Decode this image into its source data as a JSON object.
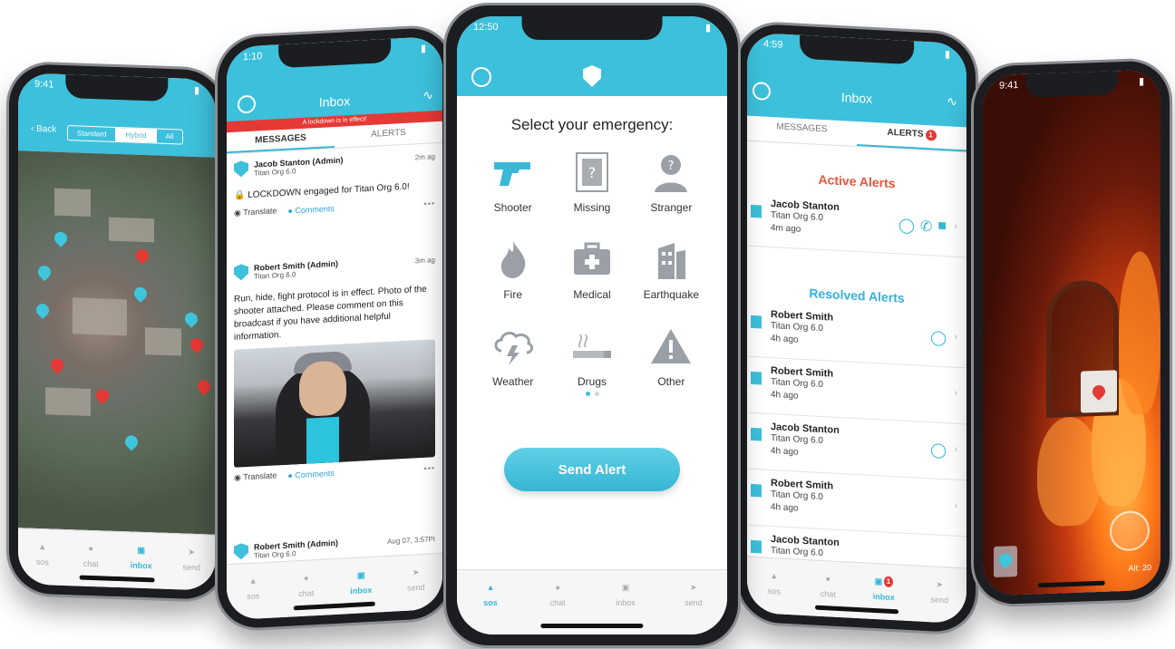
{
  "colors": {
    "accent": "#3dc0db",
    "alert_red": "#e53935",
    "active_alerts": "#e8553a",
    "resolved_alerts": "#35b0e3",
    "link": "#2f9fd6"
  },
  "tabs": {
    "sos": "sos",
    "chat": "chat",
    "inbox": "inbox",
    "send": "send"
  },
  "map_phone": {
    "time": "9:41",
    "back": "Back",
    "segments": [
      "Standard",
      "Hybrid",
      "All"
    ]
  },
  "inbox_phone": {
    "time": "1:10",
    "title": "Inbox",
    "banner": "A lockdown is in effect!",
    "tab_messages": "MESSAGES",
    "tab_alerts": "ALERTS",
    "messages": [
      {
        "from": "Jacob Stanton (Admin)",
        "org": "Titan Org 6.0",
        "time": "2m ag",
        "body": "LOCKDOWN engaged for Titan Org 6.0!",
        "translate": "Translate",
        "comments": "Comments"
      },
      {
        "from": "Robert Smith (Admin)",
        "org": "Titan Org 6.0",
        "time": "3m ag",
        "body": "Run, hide, fight protocol is in effect. Photo of the shooter attached. Please comment on this broadcast if you have additional helpful information.",
        "translate": "Translate",
        "comments": "Comments"
      },
      {
        "from": "Robert Smith (Admin)",
        "org": "Titan Org 6.0",
        "time": "Aug 07, 3:57PI"
      }
    ]
  },
  "sos_phone": {
    "time": "12:50",
    "title": "Select your emergency:",
    "emergencies": [
      {
        "label": "Shooter",
        "icon": "gun-icon"
      },
      {
        "label": "Missing",
        "icon": "missing-person-icon"
      },
      {
        "label": "Stranger",
        "icon": "stranger-icon"
      },
      {
        "label": "Fire",
        "icon": "fire-icon"
      },
      {
        "label": "Medical",
        "icon": "medical-kit-icon"
      },
      {
        "label": "Earthquake",
        "icon": "earthquake-icon"
      },
      {
        "label": "Weather",
        "icon": "storm-cloud-icon"
      },
      {
        "label": "Drugs",
        "icon": "cigarette-icon"
      },
      {
        "label": "Other",
        "icon": "warning-triangle-icon"
      }
    ],
    "send_alert": "Send Alert"
  },
  "alerts_phone": {
    "time": "4:59",
    "title": "Inbox",
    "tab_messages": "MESSAGES",
    "tab_alerts": "ALERTS",
    "alerts_badge": "1",
    "inbox_badge": "1",
    "active_title": "Active Alerts",
    "resolved_title": "Resolved Alerts",
    "active": [
      {
        "name": "Jacob Stanton",
        "org": "Titan Org 6.0",
        "time": "4m ago"
      }
    ],
    "resolved": [
      {
        "name": "Robert Smith",
        "org": "Titan Org 6.0",
        "time": "4h ago"
      },
      {
        "name": "Robert Smith",
        "org": "Titan Org 6.0",
        "time": "4h ago"
      },
      {
        "name": "Jacob Stanton",
        "org": "Titan Org 6.0",
        "time": "4h ago"
      },
      {
        "name": "Robert Smith",
        "org": "Titan Org 6.0",
        "time": "4h ago"
      },
      {
        "name": "Jacob Stanton",
        "org": "Titan Org 6.0",
        "time": ""
      }
    ]
  },
  "ar_phone": {
    "time": "9:41",
    "altitude": "Alt: 20"
  }
}
